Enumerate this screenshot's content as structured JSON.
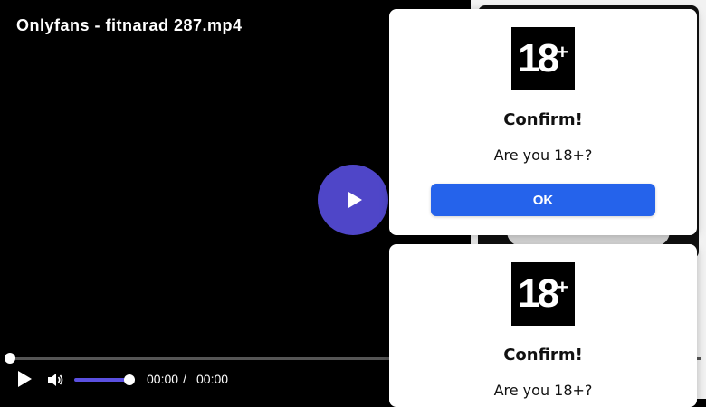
{
  "video": {
    "title": "Onlyfans - fitnarad 287.mp4",
    "current_time": "00:00",
    "separator": "/",
    "duration": "00:00",
    "progress_fraction": 0,
    "volume_fraction": 1
  },
  "icons": {
    "big_play": "play-icon",
    "play": "play-icon",
    "volume": "volume-icon"
  },
  "colors": {
    "accent": "#4f46c8",
    "ok_button": "#2563eb"
  },
  "modals": [
    {
      "badge_number": "18",
      "badge_plus": "+",
      "title": "Confirm!",
      "text": "Are you 18+?",
      "button_label": "OK"
    },
    {
      "badge_number": "18",
      "badge_plus": "+",
      "title": "Confirm!",
      "text": "Are you 18+?"
    }
  ]
}
